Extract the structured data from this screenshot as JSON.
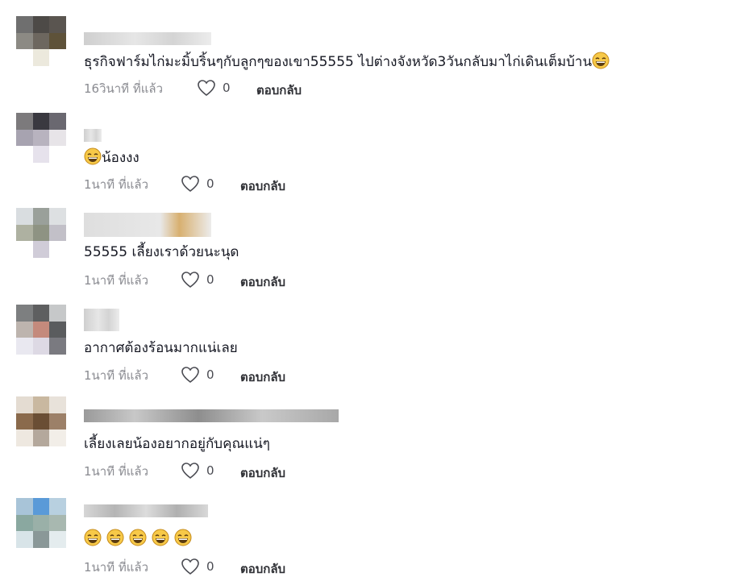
{
  "comments": [
    {
      "text": "ธุรกิจฟาร์มไก่มะมิ้บริ้นๆกับลูกๆของเขา55555 ไปต่างจังหวัด3วันกลับมาไก่เดินเต็มบ้าน",
      "trailing_emoji": "grinning-sweat",
      "time": "16วินาที ที่แล้ว",
      "likes": "0",
      "reply": "ตอบกลับ"
    },
    {
      "leading_emoji": "grinning-sweat",
      "text": "น้องงง",
      "time": "1นาที ที่แล้ว",
      "likes": "0",
      "reply": "ตอบกลับ"
    },
    {
      "text": "55555 เลี้ยงเราด้วยนะนุด",
      "time": "1นาที ที่แล้ว",
      "likes": "0",
      "reply": "ตอบกลับ"
    },
    {
      "text": "อากาศต้องร้อนมากแน่เลย",
      "time": "1นาที ที่แล้ว",
      "likes": "0",
      "reply": "ตอบกลับ"
    },
    {
      "text": "เลี้ยงเลยน้องอยากอยู่กับคุณแน่ๆ",
      "time": "1นาที ที่แล้ว",
      "likes": "0",
      "reply": "ตอบกลับ"
    },
    {
      "emoji_row": [
        "grinning-sweat",
        "grinning-sweat",
        "grinning-sweat",
        "grinning-sweat",
        "grinning-sweat"
      ],
      "time": "1นาที ที่แล้ว",
      "likes": "0",
      "reply": "ตอบกลับ"
    }
  ],
  "colors": {
    "meta": "#8a8b91",
    "reply": "#2f3035",
    "emoji_face": "#f7c948"
  }
}
